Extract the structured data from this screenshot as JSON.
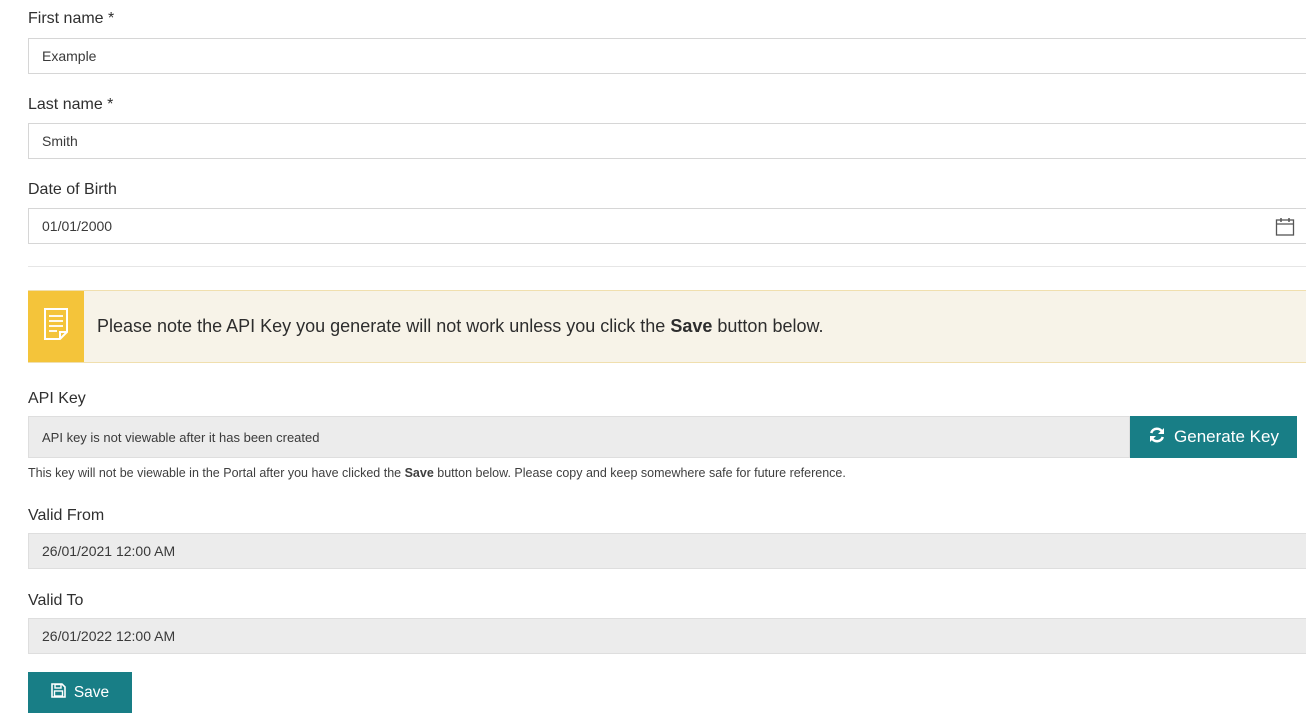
{
  "form": {
    "first_name": {
      "label": "First name *",
      "value": "Example"
    },
    "last_name": {
      "label": "Last name *",
      "value": "Smith"
    },
    "dob": {
      "label": "Date of Birth",
      "value": "01/01/2000"
    }
  },
  "notice": {
    "text_before": "Please note the API Key you generate will not work unless you click the ",
    "text_bold": "Save",
    "text_after": " button below.",
    "accent_color": "#f4c43a"
  },
  "api_key": {
    "label": "API Key",
    "value": "API key is not viewable after it has been created",
    "generate_label": "Generate Key",
    "helper_before": "This key will not be viewable in the Portal after you have clicked the ",
    "helper_bold": "Save",
    "helper_after": " button below. Please copy and keep somewhere safe for future reference."
  },
  "valid_from": {
    "label": "Valid From",
    "value": "26/01/2021 12:00 AM"
  },
  "valid_to": {
    "label": "Valid To",
    "value": "26/01/2022 12:00 AM"
  },
  "actions": {
    "save_label": "Save",
    "brand_color": "#187e86"
  },
  "icons": {
    "calendar": "calendar-icon",
    "note": "document-note-icon",
    "refresh": "refresh-icon",
    "save": "save-icon"
  }
}
